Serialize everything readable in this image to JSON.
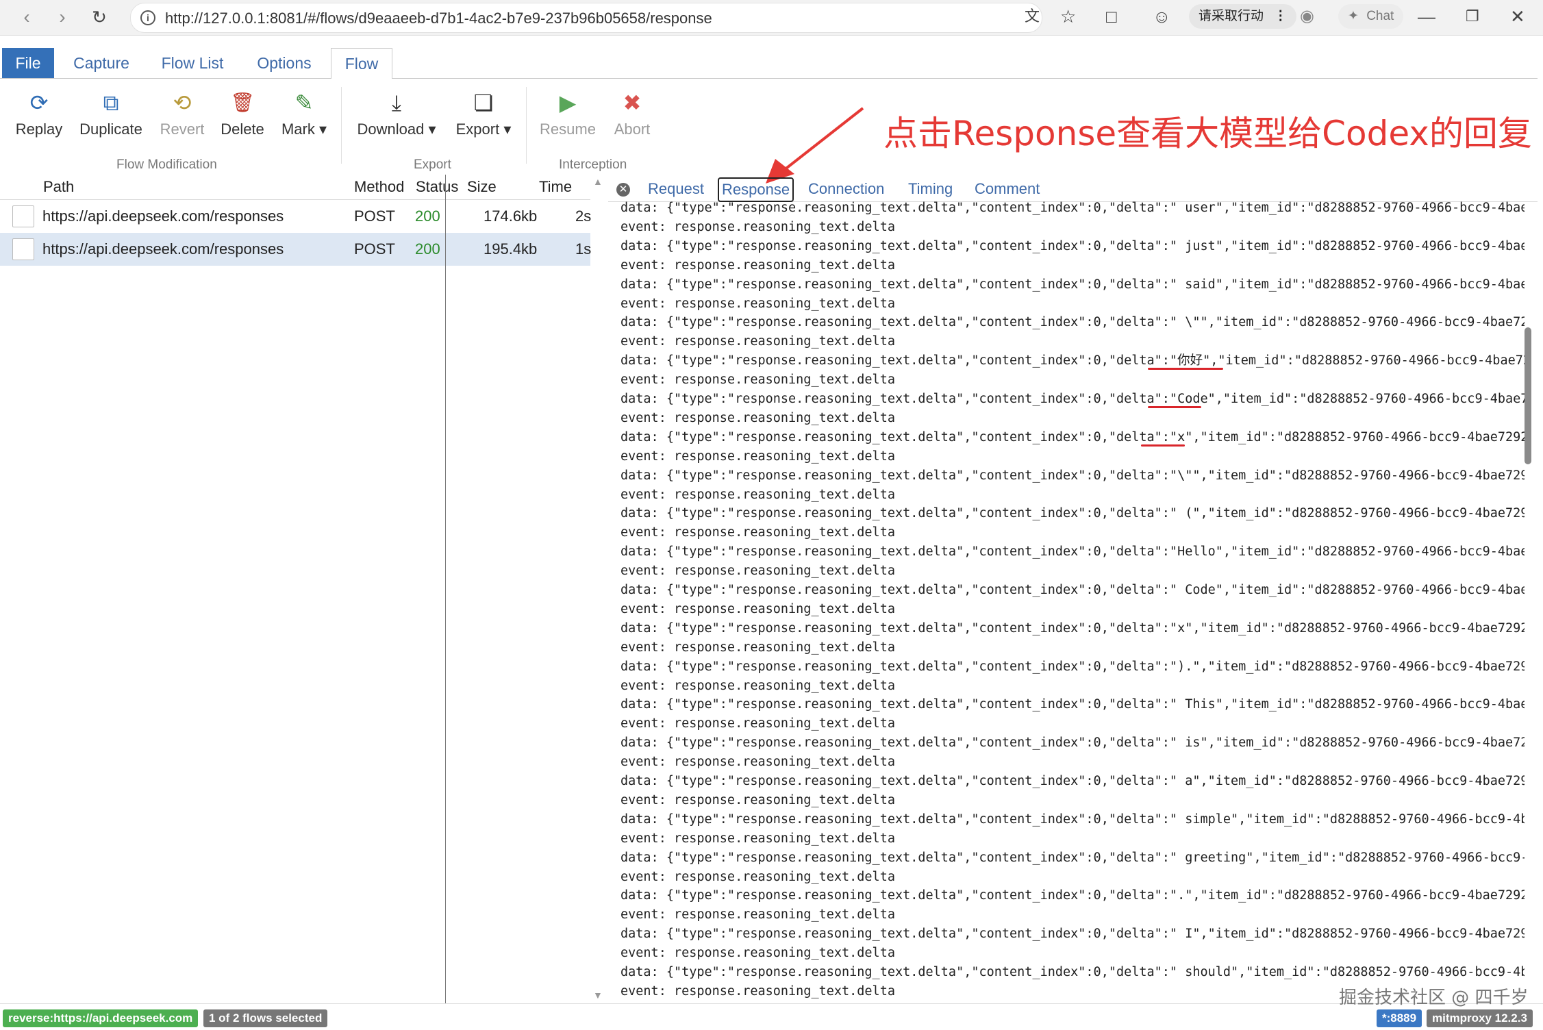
{
  "browser": {
    "url": "http://127.0.0.1:8081/#/flows/d9eaaeeb-d7b1-4ac2-b7e9-237b96b05658/response",
    "sign_in_label": "请采取行动",
    "chat_label": "Chat"
  },
  "tabs": [
    "File",
    "Capture",
    "Flow List",
    "Options",
    "Flow"
  ],
  "active_tab": "Flow",
  "toolbar": {
    "flow_modification": {
      "label": "Flow Modification",
      "buttons": [
        {
          "label": "Replay",
          "icon": "replay-icon",
          "color": "#2f6db5"
        },
        {
          "label": "Duplicate",
          "icon": "duplicate-icon",
          "color": "#2f6db5"
        },
        {
          "label": "Revert",
          "icon": "revert-icon",
          "color": "#b89a3c"
        },
        {
          "label": "Delete",
          "icon": "trash-icon",
          "color": "#c0392b"
        },
        {
          "label": "Mark",
          "icon": "brush-icon",
          "color": "#3a8a3a"
        }
      ]
    },
    "export": {
      "label": "Export",
      "buttons": [
        {
          "label": "Download",
          "icon": "download-icon"
        },
        {
          "label": "Export",
          "icon": "copy-icon"
        }
      ]
    },
    "interception": {
      "label": "Interception",
      "buttons": [
        {
          "label": "Resume",
          "icon": "play-icon",
          "color": "#5aa65a"
        },
        {
          "label": "Abort",
          "icon": "x-icon",
          "color": "#d9534f"
        }
      ]
    }
  },
  "annotation": "点击Response查看大模型给Codex的回复",
  "flow_table": {
    "headers": {
      "path": "Path",
      "method": "Method",
      "status": "Status",
      "size": "Size",
      "time": "Time"
    },
    "rows": [
      {
        "path": "https://api.deepseek.com/responses",
        "method": "POST",
        "status": "200",
        "size": "174.6kb",
        "time": "2s"
      },
      {
        "path": "https://api.deepseek.com/responses",
        "method": "POST",
        "status": "200",
        "size": "195.4kb",
        "time": "1s"
      }
    ]
  },
  "detail_tabs": [
    "Request",
    "Response",
    "Connection",
    "Timing",
    "Comment"
  ],
  "active_detail_tab": "Response",
  "response_lines": [
    "data: {\"type\":\"response.reasoning_text.delta\",\"content_index\":0,\"delta\":\" user\",\"item_id\":\"d8288852-9760-4966-bcc9-4bae7",
    "event: response.reasoning_text.delta",
    "data: {\"type\":\"response.reasoning_text.delta\",\"content_index\":0,\"delta\":\" just\",\"item_id\":\"d8288852-9760-4966-bcc9-4bae7",
    "event: response.reasoning_text.delta",
    "data: {\"type\":\"response.reasoning_text.delta\",\"content_index\":0,\"delta\":\" said\",\"item_id\":\"d8288852-9760-4966-bcc9-4bae7",
    "event: response.reasoning_text.delta",
    "data: {\"type\":\"response.reasoning_text.delta\",\"content_index\":0,\"delta\":\" \\\"\",\"item_id\":\"d8288852-9760-4966-bcc9-4bae729",
    "event: response.reasoning_text.delta",
    "data: {\"type\":\"response.reasoning_text.delta\",\"content_index\":0,\"delta\":\"你好\",\"item_id\":\"d8288852-9760-4966-bcc9-4bae72",
    "event: response.reasoning_text.delta",
    "data: {\"type\":\"response.reasoning_text.delta\",\"content_index\":0,\"delta\":\"Code\",\"item_id\":\"d8288852-9760-4966-bcc9-4bae72",
    "event: response.reasoning_text.delta",
    "data: {\"type\":\"response.reasoning_text.delta\",\"content_index\":0,\"delta\":\"x\",\"item_id\":\"d8288852-9760-4966-bcc9-4bae72928",
    "event: response.reasoning_text.delta",
    "data: {\"type\":\"response.reasoning_text.delta\",\"content_index\":0,\"delta\":\"\\\"\",\"item_id\":\"d8288852-9760-4966-bcc9-4bae7292",
    "event: response.reasoning_text.delta",
    "data: {\"type\":\"response.reasoning_text.delta\",\"content_index\":0,\"delta\":\" (\",\"item_id\":\"d8288852-9760-4966-bcc9-4bae7292",
    "event: response.reasoning_text.delta",
    "data: {\"type\":\"response.reasoning_text.delta\",\"content_index\":0,\"delta\":\"Hello\",\"item_id\":\"d8288852-9760-4966-bcc9-4bae7",
    "event: response.reasoning_text.delta",
    "data: {\"type\":\"response.reasoning_text.delta\",\"content_index\":0,\"delta\":\" Code\",\"item_id\":\"d8288852-9760-4966-bcc9-4bae7",
    "event: response.reasoning_text.delta",
    "data: {\"type\":\"response.reasoning_text.delta\",\"content_index\":0,\"delta\":\"x\",\"item_id\":\"d8288852-9760-4966-bcc9-4bae72928",
    "event: response.reasoning_text.delta",
    "data: {\"type\":\"response.reasoning_text.delta\",\"content_index\":0,\"delta\":\").\",\"item_id\":\"d8288852-9760-4966-bcc9-4bae7292",
    "event: response.reasoning_text.delta",
    "data: {\"type\":\"response.reasoning_text.delta\",\"content_index\":0,\"delta\":\" This\",\"item_id\":\"d8288852-9760-4966-bcc9-4bae7",
    "event: response.reasoning_text.delta",
    "data: {\"type\":\"response.reasoning_text.delta\",\"content_index\":0,\"delta\":\" is\",\"item_id\":\"d8288852-9760-4966-bcc9-4bae729",
    "event: response.reasoning_text.delta",
    "data: {\"type\":\"response.reasoning_text.delta\",\"content_index\":0,\"delta\":\" a\",\"item_id\":\"d8288852-9760-4966-bcc9-4bae7292",
    "event: response.reasoning_text.delta",
    "data: {\"type\":\"response.reasoning_text.delta\",\"content_index\":0,\"delta\":\" simple\",\"item_id\":\"d8288852-9760-4966-bcc9-4ba",
    "event: response.reasoning_text.delta",
    "data: {\"type\":\"response.reasoning_text.delta\",\"content_index\":0,\"delta\":\" greeting\",\"item_id\":\"d8288852-9760-4966-bcc9-4",
    "event: response.reasoning_text.delta",
    "data: {\"type\":\"response.reasoning_text.delta\",\"content_index\":0,\"delta\":\".\",\"item_id\":\"d8288852-9760-4966-bcc9-4bae72928",
    "event: response.reasoning_text.delta",
    "data: {\"type\":\"response.reasoning_text.delta\",\"content_index\":0,\"delta\":\" I\",\"item_id\":\"d8288852-9760-4966-bcc9-4bae7292",
    "event: response.reasoning_text.delta",
    "data: {\"type\":\"response.reasoning_text.delta\",\"content_index\":0,\"delta\":\" should\",\"item_id\":\"d8288852-9760-4966-bcc9-4ba",
    "event: response.reasoning_text.delta"
  ],
  "footer": {
    "reverse": "reverse:https://api.deepseek.com",
    "selection": "1 of 2 flows selected",
    "port": "*:8889",
    "version": "mitmproxy 12.2.3"
  },
  "watermark": "掘金技术社区 @ 四千岁",
  "colors": {
    "accent": "#3470b8",
    "status_ok": "#2a8a2a",
    "annotation": "#e53935",
    "footer_green": "#4caf50",
    "footer_gray": "#777777",
    "footer_blue": "#3b78c4"
  }
}
